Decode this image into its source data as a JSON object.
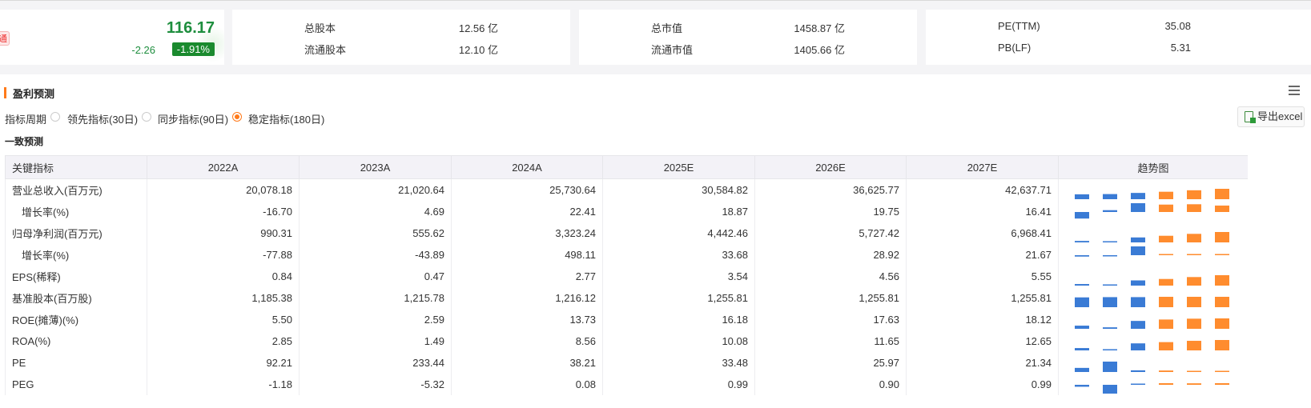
{
  "quote": {
    "badge": "通",
    "price": "116.17",
    "change": "-2.26",
    "change_pct": "-1.91%"
  },
  "stats": [
    {
      "label": "总股本",
      "value": "12.56 亿"
    },
    {
      "label": "流通股本",
      "value": "12.10 亿"
    },
    {
      "label": "总市值",
      "value": "1458.87 亿"
    },
    {
      "label": "流通市值",
      "value": "1405.66 亿"
    },
    {
      "label": "PE(TTM)",
      "value": "35.08"
    },
    {
      "label": "PB(LF)",
      "value": "5.31"
    }
  ],
  "section": {
    "title": "盈利预测",
    "period_label": "指标周期",
    "options": [
      "领先指标(30日)",
      "同步指标(90日)",
      "稳定指标(180日)"
    ],
    "selected_option": "稳定指标(180日)",
    "export_label": "导出excel",
    "subtitle": "一致预测"
  },
  "colors": {
    "accent": "#ff7a1a",
    "bar_actual": "#3a7bd5",
    "bar_estimate": "#ff8c2e",
    "up_green": "#1e8e3e"
  },
  "table": {
    "headers": [
      "关键指标",
      "2022A",
      "2023A",
      "2024A",
      "2025E",
      "2026E",
      "2027E",
      "趋势图"
    ],
    "rows": [
      {
        "name": "营业总收入(百万元)",
        "cells": [
          "20,078.18",
          "21,020.64",
          "25,730.64",
          "30,584.82",
          "36,625.77",
          "42,637.71"
        ],
        "trend": [
          20078.18,
          21020.64,
          25730.64,
          30584.82,
          36625.77,
          42637.71
        ]
      },
      {
        "name": "增长率(%)",
        "cells": [
          "-16.70",
          "4.69",
          "22.41",
          "18.87",
          "19.75",
          "16.41"
        ],
        "trend": [
          -16.7,
          4.69,
          22.41,
          18.87,
          19.75,
          16.41
        ]
      },
      {
        "name": "归母净利润(百万元)",
        "cells": [
          "990.31",
          "555.62",
          "3,323.24",
          "4,442.46",
          "5,727.42",
          "6,968.41"
        ],
        "trend": [
          990.31,
          555.62,
          3323.24,
          4442.46,
          5727.42,
          6968.41
        ]
      },
      {
        "name": "增长率(%)",
        "cells": [
          "-77.88",
          "-43.89",
          "498.11",
          "33.68",
          "28.92",
          "21.67"
        ],
        "trend": [
          -77.88,
          -43.89,
          498.11,
          33.68,
          28.92,
          21.67
        ]
      },
      {
        "name": "EPS(稀释)",
        "cells": [
          "0.84",
          "0.47",
          "2.77",
          "3.54",
          "4.56",
          "5.55"
        ],
        "trend": [
          0.84,
          0.47,
          2.77,
          3.54,
          4.56,
          5.55
        ]
      },
      {
        "name": "基准股本(百万股)",
        "cells": [
          "1,185.38",
          "1,215.78",
          "1,216.12",
          "1,255.81",
          "1,255.81",
          "1,255.81"
        ],
        "trend": [
          1185.38,
          1215.78,
          1216.12,
          1255.81,
          1255.81,
          1255.81
        ]
      },
      {
        "name": "ROE(摊薄)(%)",
        "cells": [
          "5.50",
          "2.59",
          "13.73",
          "16.18",
          "17.63",
          "18.12"
        ],
        "trend": [
          5.5,
          2.59,
          13.73,
          16.18,
          17.63,
          18.12
        ]
      },
      {
        "name": "ROA(%)",
        "cells": [
          "2.85",
          "1.49",
          "8.56",
          "10.08",
          "11.65",
          "12.65"
        ],
        "trend": [
          2.85,
          1.49,
          8.56,
          10.08,
          11.65,
          12.65
        ]
      },
      {
        "name": "PE",
        "cells": [
          "92.21",
          "233.44",
          "38.21",
          "33.48",
          "25.97",
          "21.34"
        ],
        "trend": [
          92.21,
          233.44,
          38.21,
          33.48,
          25.97,
          21.34
        ]
      },
      {
        "name": "PEG",
        "cells": [
          "-1.18",
          "-5.32",
          "0.08",
          "0.99",
          "0.90",
          "0.99"
        ],
        "trend": [
          -1.18,
          -5.32,
          0.08,
          0.99,
          0.9,
          0.99
        ]
      }
    ]
  }
}
